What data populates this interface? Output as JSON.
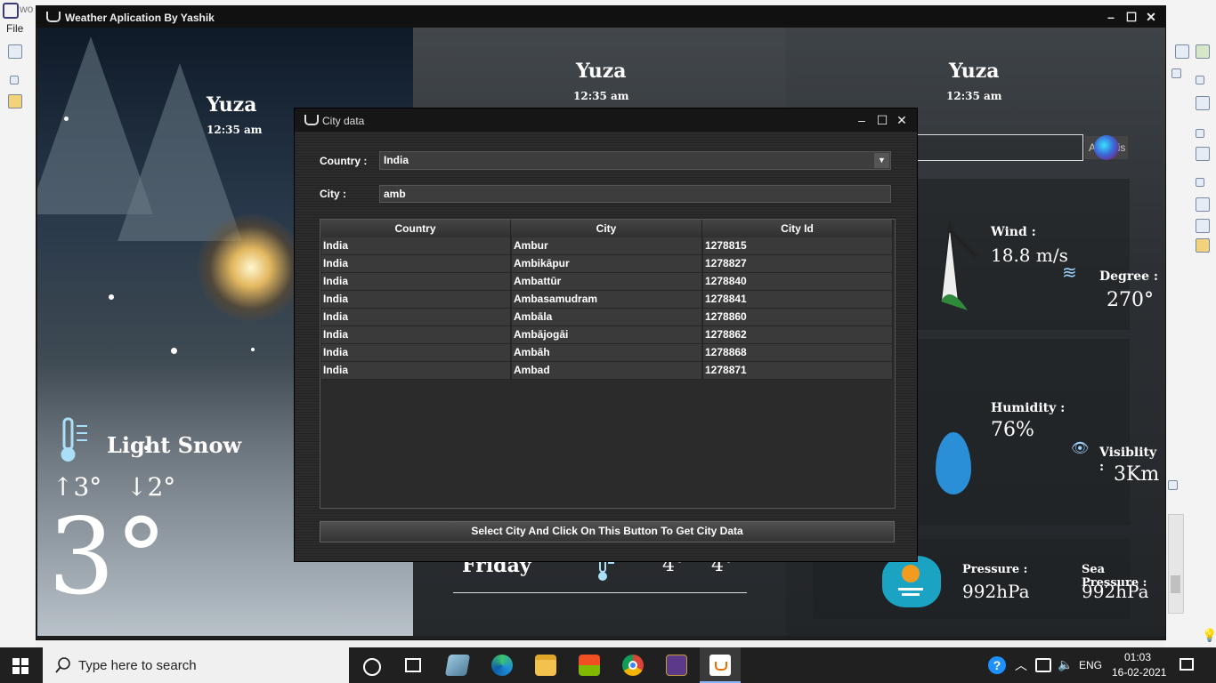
{
  "ide": {
    "title_fragment": "wo",
    "menu_file": "File"
  },
  "main_window": {
    "title": "Weather Aplication By Yashik",
    "left": {
      "city": "Yuza",
      "time": "12:35 am",
      "condition": "Light Snow",
      "high": "↑3°",
      "low": "↓2°",
      "temp": "3°"
    },
    "mid": {
      "city": "Yuza",
      "time": "12:35 am",
      "forecast_day": "Friday",
      "forecast_high": "4°",
      "forecast_low": "4°"
    },
    "right": {
      "city": "Yuza",
      "time": "12:35 am",
      "search_button_text": "A",
      "search_button_tail": "nis",
      "wind_label": "Wind :",
      "wind_value": "18.8 m/s",
      "degree_label": "Degree :",
      "degree_value": "270°",
      "humidity_label": "Humidity :",
      "humidity_value": "76%",
      "visibility_label": "Visiblity :",
      "visibility_value": "3Km",
      "pressure_label": "Pressure :",
      "pressure_value": "992hPa",
      "sea_pressure_label": "Sea Pressure :",
      "sea_pressure_value": "992hPa"
    }
  },
  "dialog": {
    "title": "City data",
    "country_label": "Country :",
    "country_value": "India",
    "city_label": "City :",
    "city_value": "amb",
    "columns": [
      "Country",
      "City",
      "City Id"
    ],
    "rows": [
      [
        "India",
        "Ambur",
        "1278815"
      ],
      [
        "India",
        "Ambikāpur",
        "1278827"
      ],
      [
        "India",
        "Ambattūr",
        "1278840"
      ],
      [
        "India",
        "Ambasamudram",
        "1278841"
      ],
      [
        "India",
        "Ambāla",
        "1278860"
      ],
      [
        "India",
        "Ambājogāi",
        "1278862"
      ],
      [
        "India",
        "Ambāh",
        "1278868"
      ],
      [
        "India",
        "Ambad",
        "1278871"
      ]
    ],
    "button_label": "Select City And Click On This Button To Get City Data"
  },
  "taskbar": {
    "search_placeholder": "Type here to search",
    "language": "ENG",
    "time": "01:03",
    "date": "16-02-2021"
  },
  "icons": [
    "windows-start-icon",
    "search-icon",
    "task-view-icon",
    "widgets-icon",
    "edge-icon",
    "file-explorer-icon",
    "store-icon",
    "chrome-icon",
    "game-icon",
    "java-icon",
    "help-icon",
    "chevron-up-icon",
    "network-icon",
    "volume-icon",
    "notification-icon",
    "thermometer-snow-icon",
    "wind-icon",
    "eye-icon",
    "pressure-gauge-icon",
    "droplet-icon"
  ]
}
